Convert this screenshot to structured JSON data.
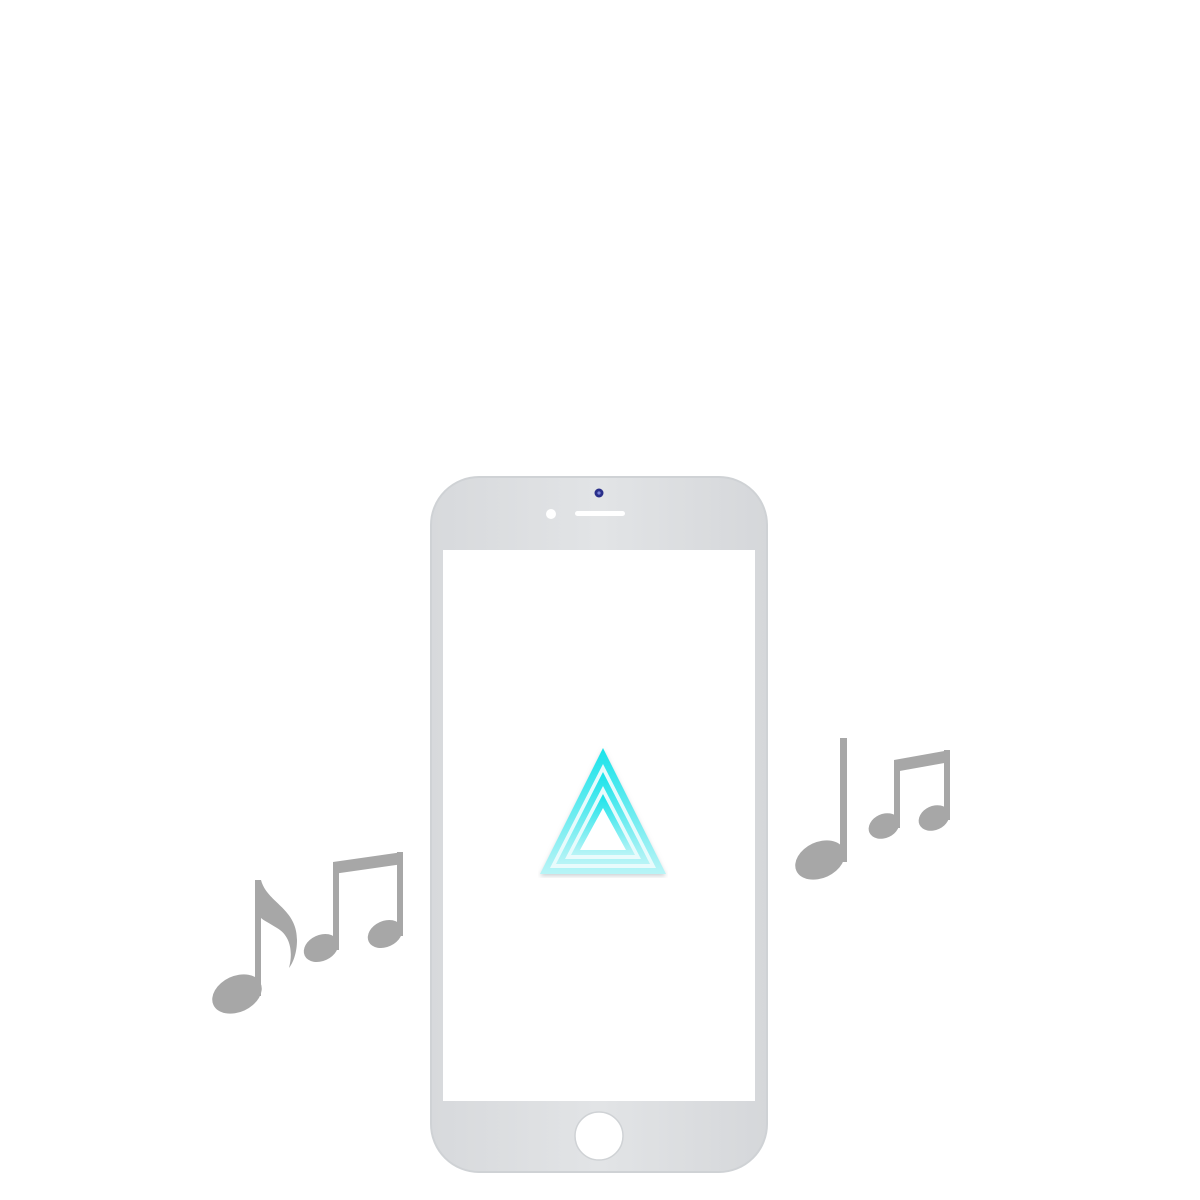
{
  "scene": {
    "description_free": true,
    "device": "smartphone-front-panel",
    "colors": {
      "background": "#ffffff",
      "phone_body": "#dfe1e3",
      "phone_edge": "#cfd2d5",
      "screen": "#ffffff",
      "notes": "#a7a7a7",
      "logo_cyan": "#19e3ea",
      "logo_light": "#d8f9fb",
      "camera": "#2a2f8a"
    },
    "icons": [
      "music-notes-icon",
      "music-notes-icon",
      "triangle-logo-icon",
      "home-button-icon"
    ]
  }
}
